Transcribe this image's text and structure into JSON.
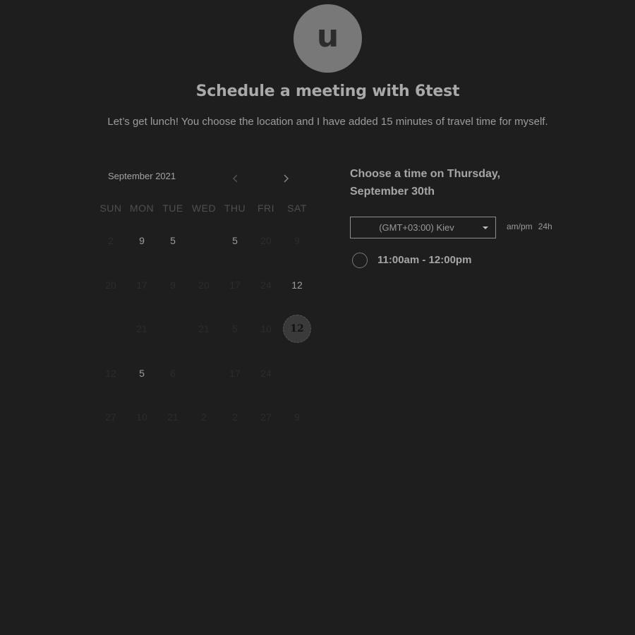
{
  "host": {
    "avatar_letter": "u",
    "title": "Schedule a meeting with 6test",
    "description": "Let’s get lunch! You choose the location and I have added 15 minutes of travel time for myself."
  },
  "calendar": {
    "month_label": "September 2021",
    "weekdays": [
      "SUN",
      "MON",
      "TUE",
      "WED",
      "THU",
      "FRI",
      "SAT"
    ],
    "weeks": [
      [
        {
          "label": "2",
          "available": false
        },
        {
          "label": "9",
          "available": true
        },
        {
          "label": "5",
          "available": true
        },
        {
          "label": "",
          "available": false
        },
        {
          "label": "5",
          "available": true
        },
        {
          "label": "20",
          "available": false
        },
        {
          "label": "9",
          "available": false
        }
      ],
      [
        {
          "label": "20",
          "available": false
        },
        {
          "label": "17",
          "available": false
        },
        {
          "label": "9",
          "available": false
        },
        {
          "label": "20",
          "available": false
        },
        {
          "label": "17",
          "available": false
        },
        {
          "label": "24",
          "available": false
        },
        {
          "label": "12",
          "available": true
        }
      ],
      [
        {
          "label": "",
          "available": false
        },
        {
          "label": "21",
          "available": false
        },
        {
          "label": "",
          "available": false
        },
        {
          "label": "21",
          "available": false
        },
        {
          "label": "5",
          "available": false
        },
        {
          "label": "10",
          "available": false
        },
        {
          "label": "12",
          "available": true,
          "selected": true
        }
      ],
      [
        {
          "label": "12",
          "available": false
        },
        {
          "label": "5",
          "available": true
        },
        {
          "label": "6",
          "available": false
        },
        {
          "label": "",
          "available": false
        },
        {
          "label": "17",
          "available": false
        },
        {
          "label": "24",
          "available": false
        },
        {
          "label": "",
          "available": false
        }
      ],
      [
        {
          "label": "27",
          "available": false
        },
        {
          "label": "10",
          "available": false
        },
        {
          "label": "21",
          "available": false
        },
        {
          "label": "2",
          "available": false
        },
        {
          "label": "2",
          "available": false
        },
        {
          "label": "27",
          "available": false
        },
        {
          "label": "9",
          "available": false
        }
      ]
    ]
  },
  "times": {
    "heading": "Choose a time on Thursday, September 30th",
    "timezone": "(GMT+03:00) Kiev",
    "format_options": [
      "am/pm",
      "24h"
    ],
    "slots": [
      "11:00am - 12:00pm"
    ]
  },
  "colors": {
    "background": "#1e1e1e",
    "avatar": "#787878",
    "text": "#a6a6a6",
    "muted_day": "#2c2c2c"
  }
}
